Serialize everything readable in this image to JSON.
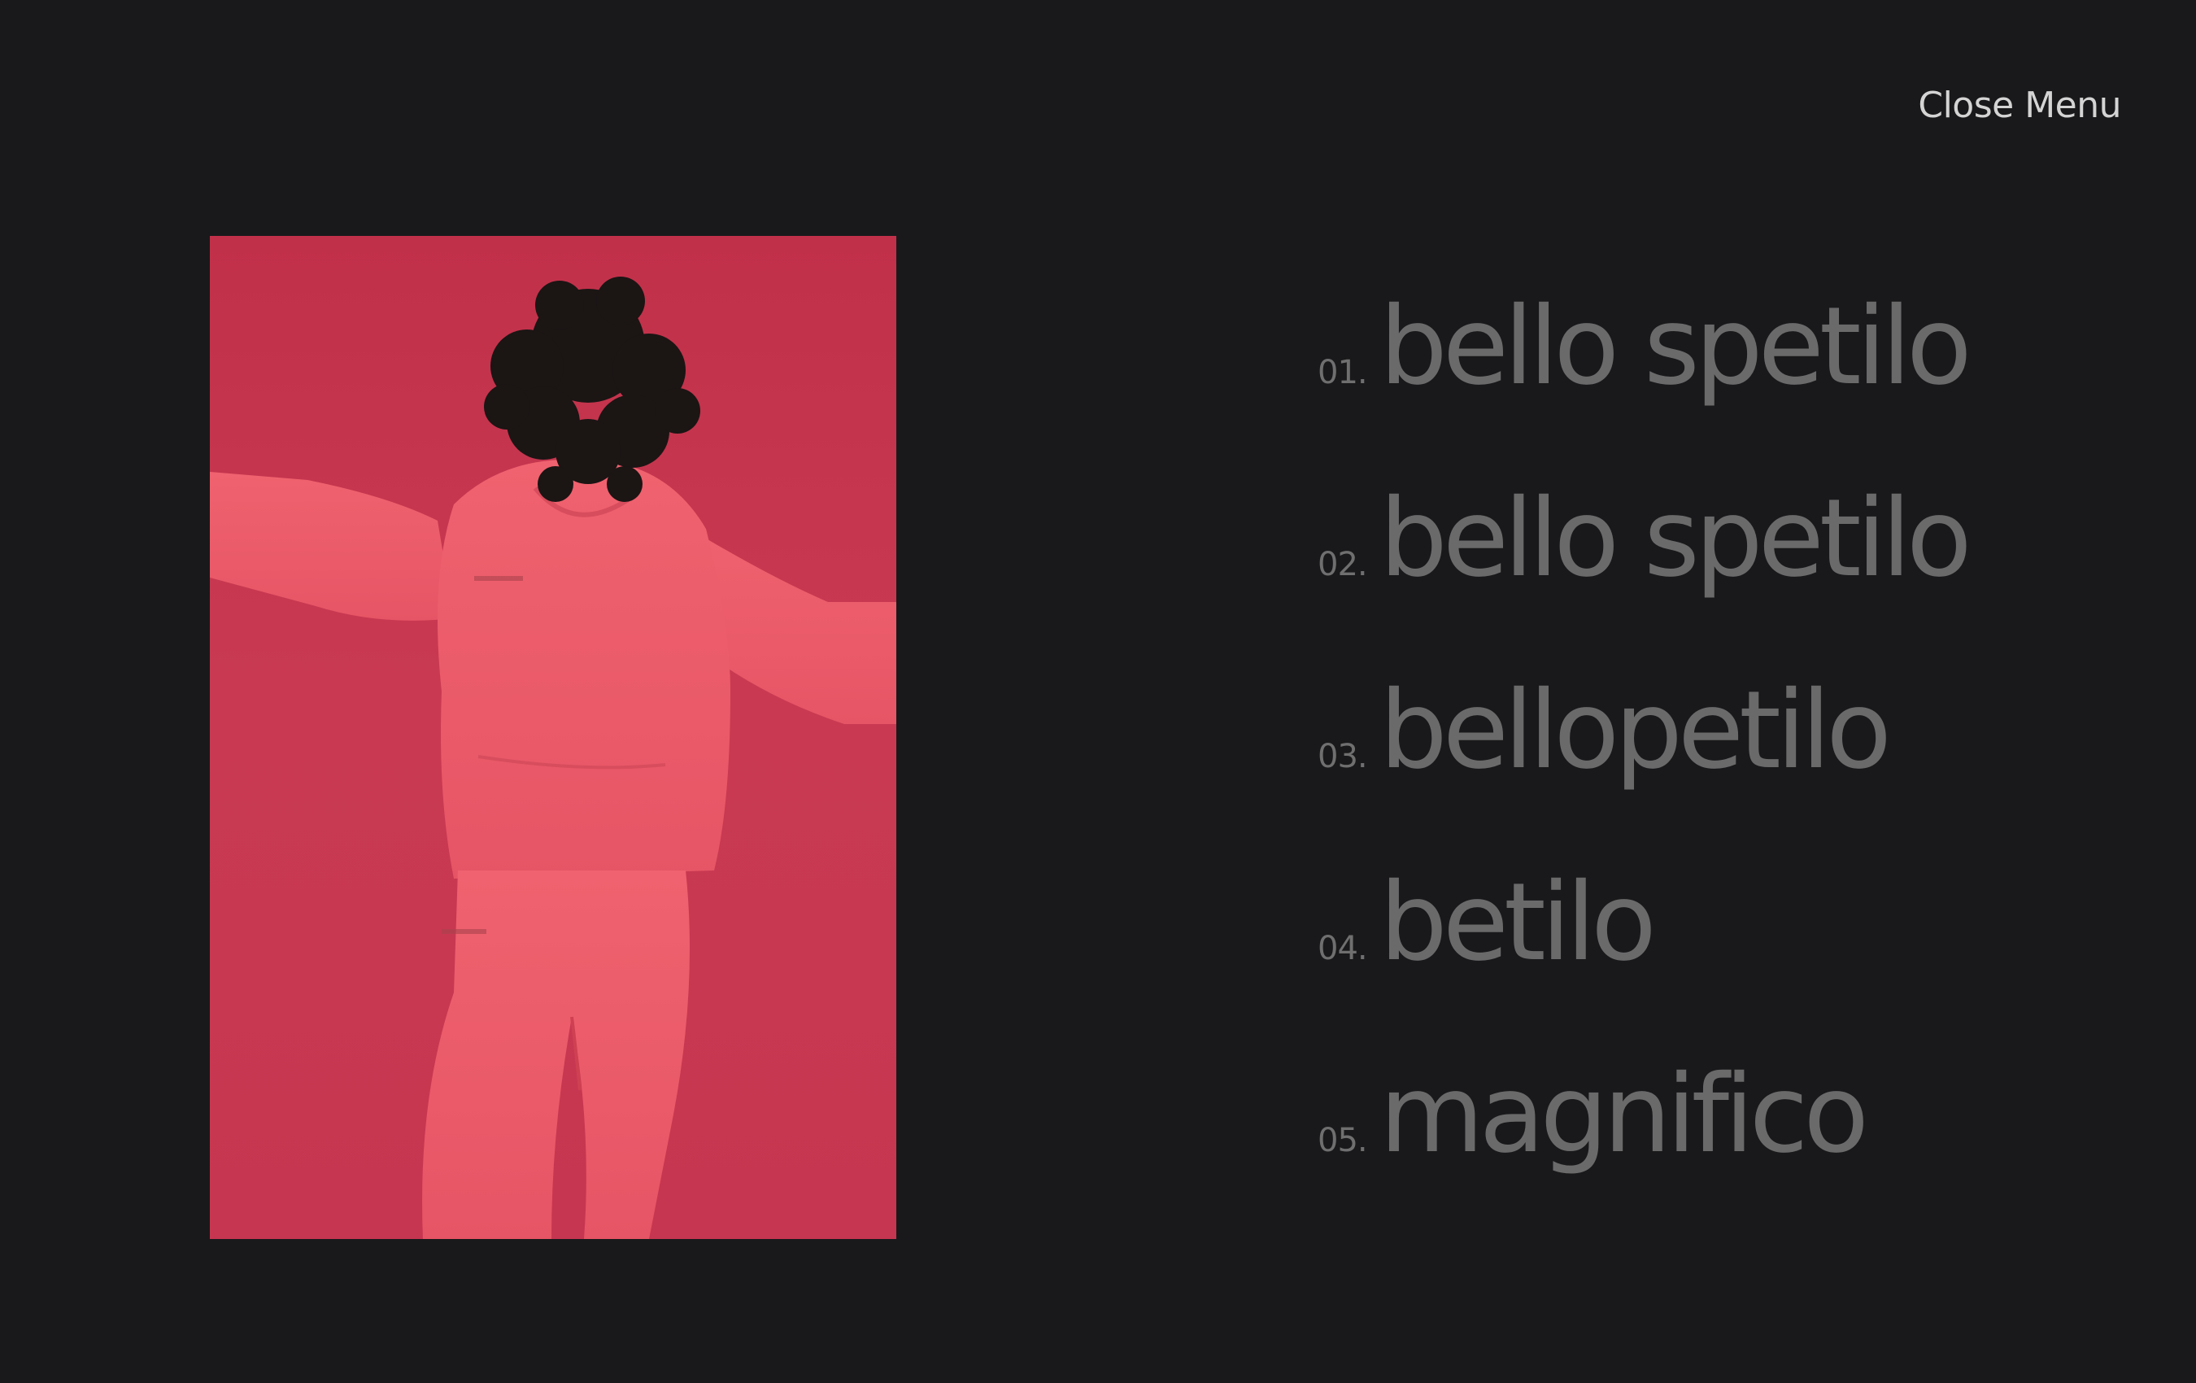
{
  "header": {
    "close_label": "Close Menu"
  },
  "hero": {
    "image_kind": "photo",
    "background_color": "#c8354f"
  },
  "menu": {
    "items": [
      {
        "number": "01.",
        "label": "bello spetilo"
      },
      {
        "number": "02.",
        "label": "bello spetilo"
      },
      {
        "number": "03.",
        "label": "bellopetilo"
      },
      {
        "number": "04.",
        "label": "betilo"
      },
      {
        "number": "05.",
        "label": "magnifico"
      }
    ]
  },
  "colors": {
    "background": "#19191b",
    "menu_text": "#6a6a6b",
    "close_text": "#d4d4d4"
  }
}
